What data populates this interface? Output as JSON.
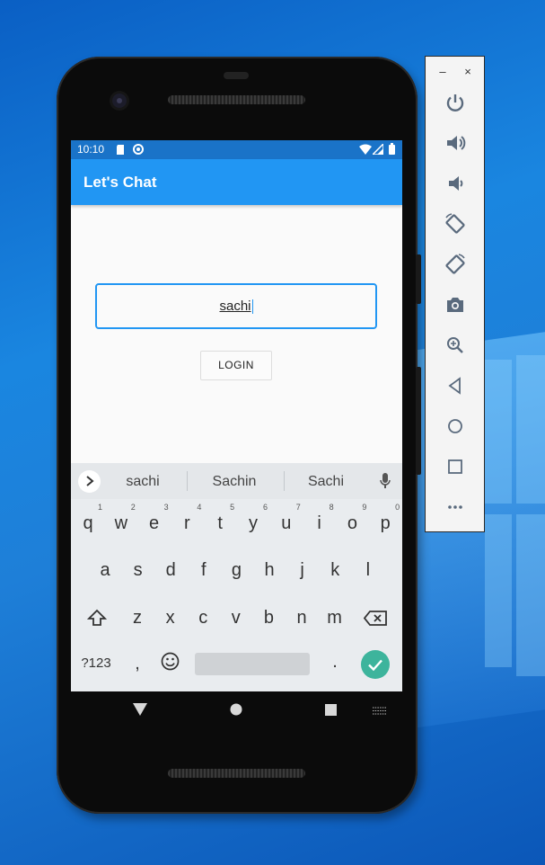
{
  "desktop": {
    "accent": "#1a86e0"
  },
  "status_bar": {
    "time": "10:10",
    "icons": [
      "sd-card-icon",
      "sync-icon",
      "wifi-icon",
      "signal-icon",
      "battery-icon"
    ]
  },
  "app_bar": {
    "title": "Let's Chat",
    "color": "#2196f3"
  },
  "login_form": {
    "username_value": "sachi",
    "login_label": "LOGIN"
  },
  "keyboard": {
    "suggestions": [
      "sachi",
      "Sachin",
      "Sachi"
    ],
    "row1": [
      {
        "k": "q",
        "n": "1"
      },
      {
        "k": "w",
        "n": "2"
      },
      {
        "k": "e",
        "n": "3"
      },
      {
        "k": "r",
        "n": "4"
      },
      {
        "k": "t",
        "n": "5"
      },
      {
        "k": "y",
        "n": "6"
      },
      {
        "k": "u",
        "n": "7"
      },
      {
        "k": "i",
        "n": "8"
      },
      {
        "k": "o",
        "n": "9"
      },
      {
        "k": "p",
        "n": "0"
      }
    ],
    "row2": [
      "a",
      "s",
      "d",
      "f",
      "g",
      "h",
      "j",
      "k",
      "l"
    ],
    "row3": [
      "z",
      "x",
      "c",
      "v",
      "b",
      "n",
      "m"
    ],
    "symbols_label": "?123",
    "comma": ",",
    "period": ".",
    "enter_color": "#3db49c"
  },
  "emulator_toolbar": {
    "minimize": "–",
    "close": "×",
    "tools": [
      "power-icon",
      "volume-up-icon",
      "volume-down-icon",
      "rotate-left-icon",
      "rotate-right-icon",
      "camera-icon",
      "zoom-icon",
      "back-icon",
      "home-icon",
      "overview-icon",
      "more-icon"
    ]
  }
}
